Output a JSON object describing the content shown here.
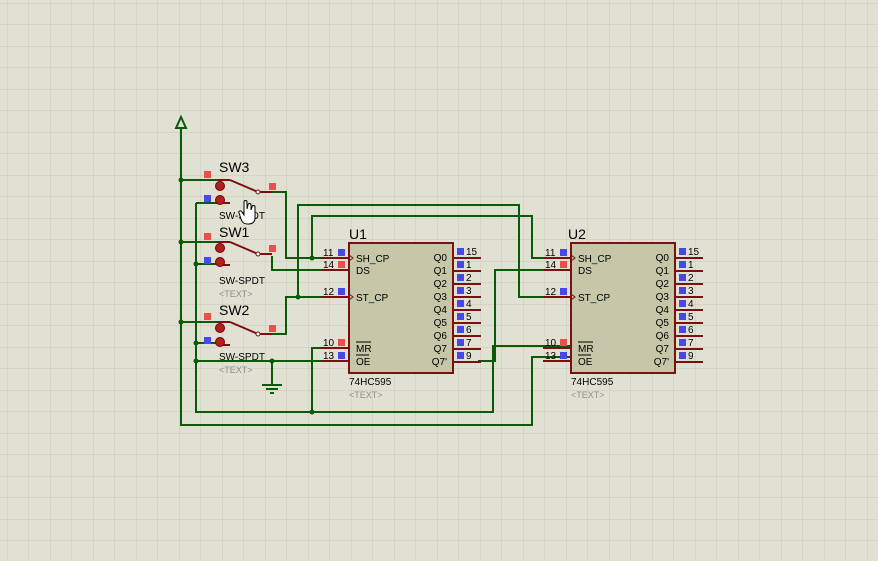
{
  "power_label": "",
  "switches": [
    {
      "ref": "SW3",
      "type": "SW-SPDT",
      "text": ""
    },
    {
      "ref": "SW1",
      "type": "SW-SPDT",
      "text": "<TEXT>"
    },
    {
      "ref": "SW2",
      "type": "SW-SPDT",
      "text": "<TEXT>"
    }
  ],
  "chips": [
    {
      "ref": "U1",
      "part": "74HC595",
      "text": "<TEXT>",
      "left_pins": [
        {
          "num": "11",
          "name": "SH_CP"
        },
        {
          "num": "14",
          "name": "DS"
        },
        {
          "num": "12",
          "name": "ST_CP"
        },
        {
          "num": "10",
          "name": "MR"
        },
        {
          "num": "13",
          "name": "OE"
        }
      ],
      "right_pins": [
        {
          "num": "15",
          "name": "Q0"
        },
        {
          "num": "1",
          "name": "Q1"
        },
        {
          "num": "2",
          "name": "Q2"
        },
        {
          "num": "3",
          "name": "Q3"
        },
        {
          "num": "4",
          "name": "Q4"
        },
        {
          "num": "5",
          "name": "Q5"
        },
        {
          "num": "6",
          "name": "Q6"
        },
        {
          "num": "7",
          "name": "Q7"
        },
        {
          "num": "9",
          "name": "Q7'"
        }
      ]
    },
    {
      "ref": "U2",
      "part": "74HC595",
      "text": "<TEXT>",
      "left_pins": [
        {
          "num": "11",
          "name": "SH_CP"
        },
        {
          "num": "14",
          "name": "DS"
        },
        {
          "num": "12",
          "name": "ST_CP"
        },
        {
          "num": "10",
          "name": "MR"
        },
        {
          "num": "13",
          "name": "OE"
        }
      ],
      "right_pins": [
        {
          "num": "15",
          "name": "Q0"
        },
        {
          "num": "1",
          "name": "Q1"
        },
        {
          "num": "2",
          "name": "Q2"
        },
        {
          "num": "3",
          "name": "Q3"
        },
        {
          "num": "4",
          "name": "Q4"
        },
        {
          "num": "5",
          "name": "Q5"
        },
        {
          "num": "6",
          "name": "Q6"
        },
        {
          "num": "7",
          "name": "Q7"
        },
        {
          "num": "9",
          "name": "Q7'"
        }
      ]
    }
  ],
  "colors": {
    "grid": "#c9c9bb",
    "wire": "#0a5a0a",
    "pin": "#7a1010",
    "chip_body": "#c6c6a9",
    "pin_marker_red": "#e8504c",
    "pin_marker_blue": "#4848e8"
  },
  "cursor_icon": "hand-pointer-icon"
}
